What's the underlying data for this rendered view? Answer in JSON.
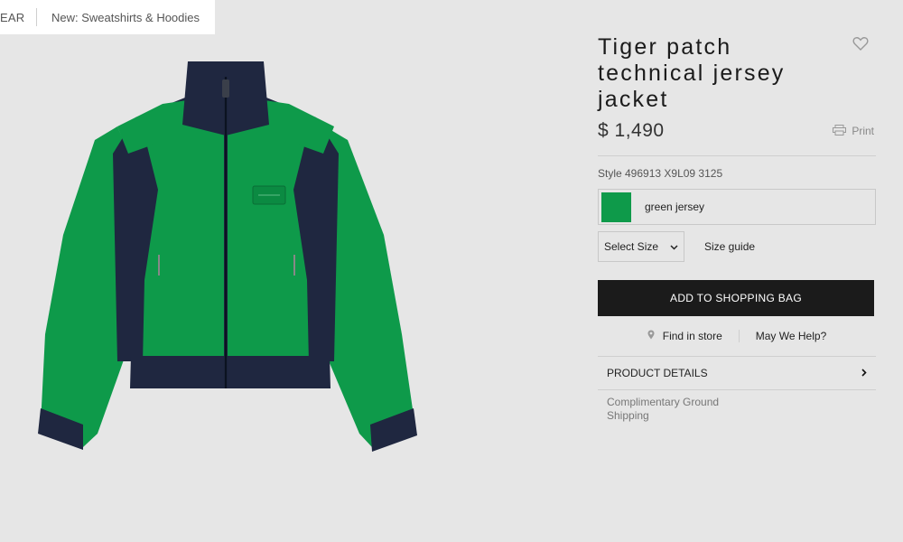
{
  "breadcrumb": {
    "items": [
      "EAR",
      "New: Sweatshirts & Hoodies"
    ]
  },
  "product": {
    "title": "Tiger patch technical jersey jacket",
    "price": "$ 1,490",
    "style": "Style 496913 X9L09 3125",
    "color_name": "green jersey",
    "color_hex": "#0e9a4a",
    "secondary_hex": "#1f2740"
  },
  "actions": {
    "print_label": "Print",
    "size_select_label": "Select Size",
    "size_guide_label": "Size guide",
    "add_to_bag_label": "ADD TO SHOPPING BAG",
    "find_in_store_label": "Find in store",
    "may_we_help_label": "May We Help?",
    "product_details_label": "PRODUCT DETAILS"
  },
  "shipping": {
    "note": "Complimentary Ground Shipping"
  },
  "icons": {
    "wishlist": "heart-icon",
    "print": "printer-icon",
    "dropdown": "chevron-down-icon",
    "store": "location-pin-icon",
    "details": "chevron-right-icon"
  }
}
